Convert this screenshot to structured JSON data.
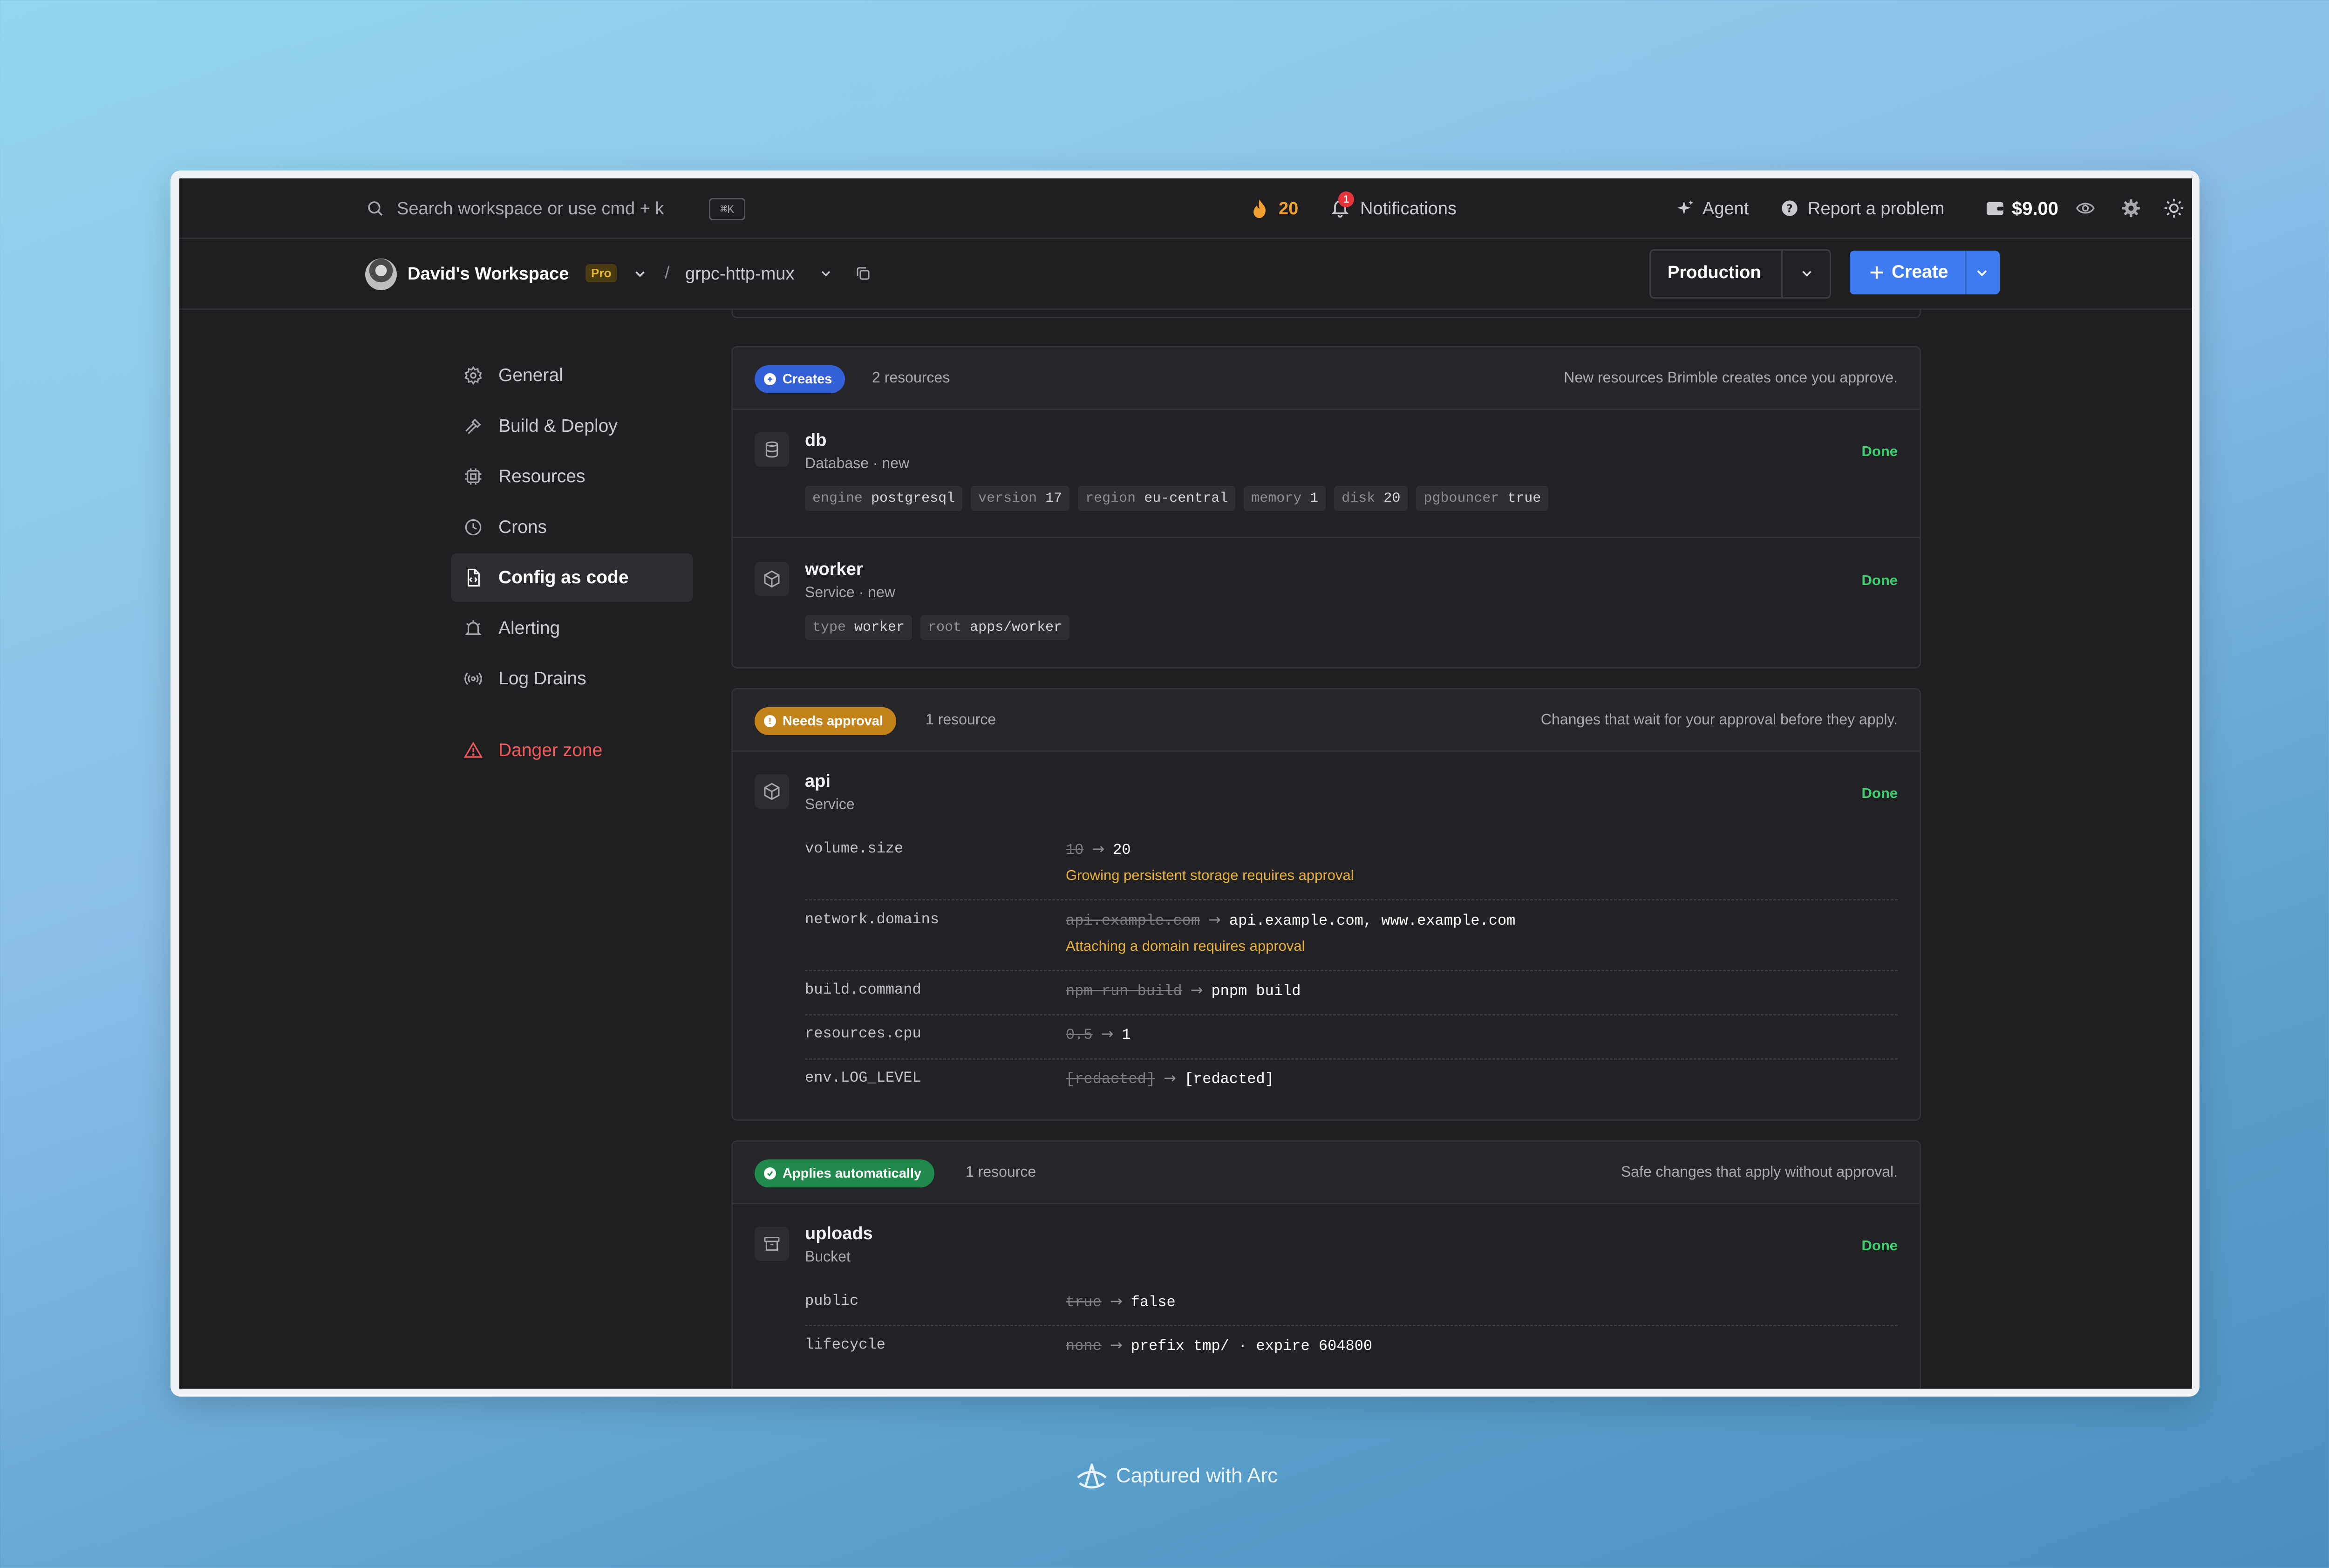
{
  "topbar": {
    "search_placeholder": "Search workspace or use cmd + k",
    "search_kbd": "⌘K",
    "streak_count": "20",
    "notifications_badge": "1",
    "notifications_label": "Notifications",
    "agent_label": "Agent",
    "report_label": "Report a problem",
    "balance": "$9.00"
  },
  "subbar": {
    "workspace_name": "David's Workspace",
    "plan_badge": "Pro",
    "separator": "/",
    "project_name": "grpc-http-mux",
    "environment": "Production",
    "create_label": "Create"
  },
  "sidebar": {
    "items": [
      {
        "label": "General"
      },
      {
        "label": "Build & Deploy"
      },
      {
        "label": "Resources"
      },
      {
        "label": "Crons"
      },
      {
        "label": "Config as code"
      },
      {
        "label": "Alerting"
      },
      {
        "label": "Log Drains"
      }
    ],
    "danger_label": "Danger zone"
  },
  "groups": {
    "creates": {
      "badge": "Creates",
      "count": "2 resources",
      "description": "New resources Brimble creates once you approve.",
      "resources": [
        {
          "name": "db",
          "subtitle": "Database · new",
          "status": "Done",
          "tags": [
            {
              "k": "engine",
              "v": "postgresql"
            },
            {
              "k": "version",
              "v": "17"
            },
            {
              "k": "region",
              "v": "eu-central"
            },
            {
              "k": "memory",
              "v": "1"
            },
            {
              "k": "disk",
              "v": "20"
            },
            {
              "k": "pgbouncer",
              "v": "true"
            }
          ]
        },
        {
          "name": "worker",
          "subtitle": "Service · new",
          "status": "Done",
          "tags": [
            {
              "k": "type",
              "v": "worker"
            },
            {
              "k": "root",
              "v": "apps/worker"
            }
          ]
        }
      ]
    },
    "needs_approval": {
      "badge": "Needs approval",
      "count": "1 resource",
      "description": "Changes that wait for your approval before they apply.",
      "resource": {
        "name": "api",
        "subtitle": "Service",
        "status": "Done",
        "changes": [
          {
            "key": "volume.size",
            "old": "10",
            "new": "20",
            "note": "Growing persistent storage requires approval"
          },
          {
            "key": "network.domains",
            "old": "api.example.com",
            "new": "api.example.com, www.example.com",
            "note": "Attaching a domain requires approval"
          },
          {
            "key": "build.command",
            "old": "npm run build",
            "new": "pnpm build"
          },
          {
            "key": "resources.cpu",
            "old": "0.5",
            "new": "1"
          },
          {
            "key": "env.LOG_LEVEL",
            "old": "[redacted]",
            "new": "[redacted]"
          }
        ]
      }
    },
    "applies_automatically": {
      "badge": "Applies automatically",
      "count": "1 resource",
      "description": "Safe changes that apply without approval.",
      "resource": {
        "name": "uploads",
        "subtitle": "Bucket",
        "status": "Done",
        "changes": [
          {
            "key": "public",
            "old": "true",
            "new": "false"
          },
          {
            "key": "lifecycle",
            "old": "none",
            "new": "prefix tmp/ · expire 604800"
          }
        ]
      }
    }
  },
  "footer": {
    "caption": "Captured with Arc"
  },
  "colors": {
    "accent": "#3f7bf0",
    "success": "#3ecf6e",
    "warning": "#e8b23a",
    "danger": "#f05a5a",
    "streak": "#f0a030"
  }
}
